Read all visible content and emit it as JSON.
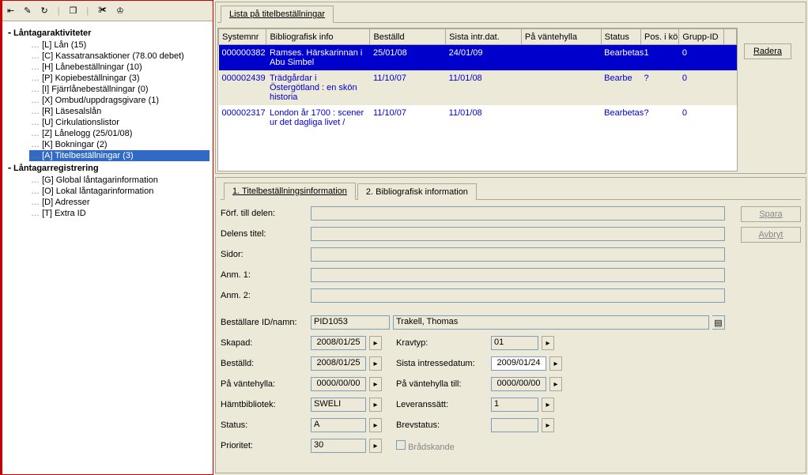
{
  "toolbar_icons": [
    "exit-icon",
    "pin-icon",
    "refresh-icon",
    "copy-icon",
    "bug-icon",
    "gift-icon"
  ],
  "tree": {
    "aktiviteter": {
      "label": "Låntagaraktiviteter",
      "items": [
        "[L] Lån (15)",
        "[C] Kassatransaktioner (78.00 debet)",
        "[H] Lånebeställningar (10)",
        "[P] Kopiebeställningar (3)",
        "[I] Fjärrlånebeställningar (0)",
        "[X] Ombud/uppdragsgivare (1)",
        "[R] Läsesalslån",
        "[U] Cirkulationslistor",
        "[Z] Lånelogg (25/01/08)",
        "[K] Bokningar (2)",
        "[A] Titelbeställningar (3)"
      ],
      "selected": 10
    },
    "registrering": {
      "label": "Låntagarregistrering",
      "items": [
        "[G] Global låntagarinformation",
        "[O] Lokal låntagarinformation",
        "[D] Adresser",
        "[T] Extra ID"
      ]
    }
  },
  "top_tabs": {
    "list": "Lista på titelbeställningar"
  },
  "table": {
    "headers": {
      "systemnr": "Systemnr",
      "biblio": "Bibliografisk info",
      "bestalld": "Beställd",
      "sista": "Sista intr.dat.",
      "vante": "På väntehylla",
      "status": "Status",
      "pos": "Pos. i kö",
      "grupp": "Grupp-ID"
    },
    "rows": [
      {
        "systemnr": "000000382",
        "biblio": "Ramses. Härskarinnan i Abu Simbel",
        "bestalld": "25/01/08",
        "sista": "24/01/09",
        "vante": "",
        "status": "Bearbetas",
        "pos": "1",
        "grupp": "0"
      },
      {
        "systemnr": "000002439",
        "biblio": "Trädgårdar i Östergötland : en skön historia",
        "bestalld": "11/10/07",
        "sista": "11/01/08",
        "vante": "",
        "status": "Bearbe",
        "pos": "?",
        "grupp": "0"
      },
      {
        "systemnr": "000002317",
        "biblio": "London år 1700 : scener ur det dagliga livet /",
        "bestalld": "11/10/07",
        "sista": "11/01/08",
        "vante": "",
        "status": "Bearbetas",
        "pos": "?",
        "grupp": "0"
      }
    ]
  },
  "radera": "Radera",
  "bottom_tabs": {
    "t1": "1. Titelbeställningsinformation",
    "t2": "2. Bibliografisk information"
  },
  "form": {
    "forf": "Förf. till delen:",
    "delens": "Delens titel:",
    "sidor": "Sidor:",
    "anm1": "Anm. 1:",
    "anm2": "Anm. 2:",
    "bestallare": "Beställare ID/namn:",
    "bestallare_id": "PID1053",
    "bestallare_namn": "Trakell, Thomas",
    "skapad": "Skapad:",
    "skapad_v": "2008/01/25",
    "bestalld": "Beställd:",
    "bestalld_v": "2008/01/25",
    "pavante": "På väntehylla:",
    "pavante_v": "0000/00/00",
    "hamt": "Hämtbibliotek:",
    "hamt_v": "SWELI",
    "status": "Status:",
    "status_v": "A",
    "prioritet": "Prioritet:",
    "prioritet_v": "30",
    "kravtyp": "Kravtyp:",
    "kravtyp_v": "01",
    "sistaint": "Sista intressedatum:",
    "sistaint_v": "2009/01/24",
    "pavantetill": "På väntehylla till:",
    "pavantetill_v": "0000/00/00",
    "leverans": "Leveranssätt:",
    "leverans_v": "1",
    "brevstatus": "Brevstatus:",
    "bradskande": "Brådskande"
  },
  "spara": "Spara",
  "avbryt": "Avbryt"
}
